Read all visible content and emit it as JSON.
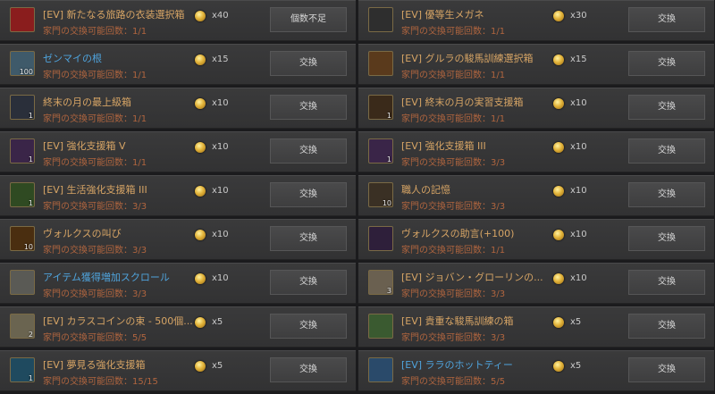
{
  "left": [
    {
      "name": "[EV] 新たなる旅路の衣装選択箱",
      "limit": "家門の交換可能回数：1/1",
      "price": "x40",
      "button": "個数不足",
      "icon": "costume-box-icon",
      "name_color": "orange",
      "icon_bg": "#8a1d1d",
      "qty": ""
    },
    {
      "name": "ゼンマイの根",
      "limit": "家門の交換可能回数：1/1",
      "price": "x15",
      "button": "交換",
      "icon": "fern-root-icon",
      "name_color": "blue",
      "icon_bg": "#3f5a6a",
      "qty": "100"
    },
    {
      "name": "終末の月の最上級箱",
      "limit": "家門の交換可能回数：1/1",
      "price": "x10",
      "button": "交換",
      "icon": "silver-chest-icon",
      "name_color": "orange",
      "icon_bg": "#2a2f3a",
      "qty": "1"
    },
    {
      "name": "[EV] 強化支援箱 V",
      "limit": "家門の交換可能回数：1/1",
      "price": "x10",
      "button": "交換",
      "icon": "purple-box-icon",
      "name_color": "orange",
      "icon_bg": "#3a2548",
      "qty": "1"
    },
    {
      "name": "[EV] 生活強化支援箱 III",
      "limit": "家門の交換可能回数：3/3",
      "price": "x10",
      "button": "交換",
      "icon": "green-box-icon",
      "name_color": "orange",
      "icon_bg": "#2f4a22",
      "qty": "1"
    },
    {
      "name": "ヴォルクスの叫び",
      "limit": "家門の交換可能回数：3/3",
      "price": "x10",
      "button": "交換",
      "icon": "orb-icon",
      "name_color": "orange",
      "icon_bg": "#4a2e10",
      "qty": "10"
    },
    {
      "name": "アイテム獲得増加スクロール",
      "limit": "家門の交換可能回数：3/3",
      "price": "x10",
      "button": "交換",
      "icon": "scroll-icon",
      "name_color": "blue",
      "icon_bg": "#5a5a55",
      "qty": ""
    },
    {
      "name": "[EV] カラスコインの束 - 500個...",
      "limit": "家門の交換可能回数：5/5",
      "price": "x5",
      "button": "交換",
      "icon": "coin-bundle-icon",
      "name_color": "orange",
      "icon_bg": "#6a6450",
      "qty": "2"
    },
    {
      "name": "[EV] 夢見る強化支援箱",
      "limit": "家門の交換可能回数：15/15",
      "price": "x5",
      "button": "交換",
      "icon": "blue-box-icon",
      "name_color": "orange",
      "icon_bg": "#1f4a5f",
      "qty": "1"
    }
  ],
  "right": [
    {
      "name": "[EV] 優等生メガネ",
      "limit": "家門の交換可能回数：1/1",
      "price": "x30",
      "button": "交換",
      "icon": "glasses-icon",
      "name_color": "orange",
      "icon_bg": "#2e2e2e",
      "qty": ""
    },
    {
      "name": "[EV] グルラの駿馬訓練選択箱",
      "limit": "家門の交換可能回数：1/1",
      "price": "x15",
      "button": "交換",
      "icon": "treasure-chest-icon",
      "name_color": "orange",
      "icon_bg": "#5a3a1c",
      "qty": ""
    },
    {
      "name": "[EV] 終末の月の実習支援箱",
      "limit": "家門の交換可能回数：1/1",
      "price": "x10",
      "button": "交換",
      "icon": "gold-chest-icon",
      "name_color": "orange",
      "icon_bg": "#3a2a1a",
      "qty": "1"
    },
    {
      "name": "[EV] 強化支援箱 III",
      "limit": "家門の交換可能回数：3/3",
      "price": "x10",
      "button": "交換",
      "icon": "purple-box-icon",
      "name_color": "orange",
      "icon_bg": "#3a2548",
      "qty": "1"
    },
    {
      "name": "職人の記憶",
      "limit": "家門の交換可能回数：3/3",
      "price": "x10",
      "button": "交換",
      "icon": "pendant-icon",
      "name_color": "orange",
      "icon_bg": "#3a3024",
      "qty": "10"
    },
    {
      "name": "ヴォルクスの助言(+100)",
      "limit": "家門の交換可能回数：1/1",
      "price": "x10",
      "button": "交換",
      "icon": "book-icon",
      "name_color": "orange",
      "icon_bg": "#2e1f3a",
      "qty": ""
    },
    {
      "name": "[EV] ジョバン・グローリンの...",
      "limit": "家門の交換可能回数：3/3",
      "price": "x10",
      "button": "交換",
      "icon": "letter-icon",
      "name_color": "orange",
      "icon_bg": "#6a6050",
      "qty": "3"
    },
    {
      "name": "[EV] 貴重な駿馬訓練の箱",
      "limit": "家門の交換可能回数：3/3",
      "price": "x5",
      "button": "交換",
      "icon": "gift-box-icon",
      "name_color": "orange",
      "icon_bg": "#3a5a30",
      "qty": ""
    },
    {
      "name": "[EV] ララのホットティー",
      "limit": "家門の交換可能回数：5/5",
      "price": "x5",
      "button": "交換",
      "icon": "tea-cup-icon",
      "name_color": "blue",
      "icon_bg": "#2a4a6a",
      "qty": ""
    }
  ]
}
